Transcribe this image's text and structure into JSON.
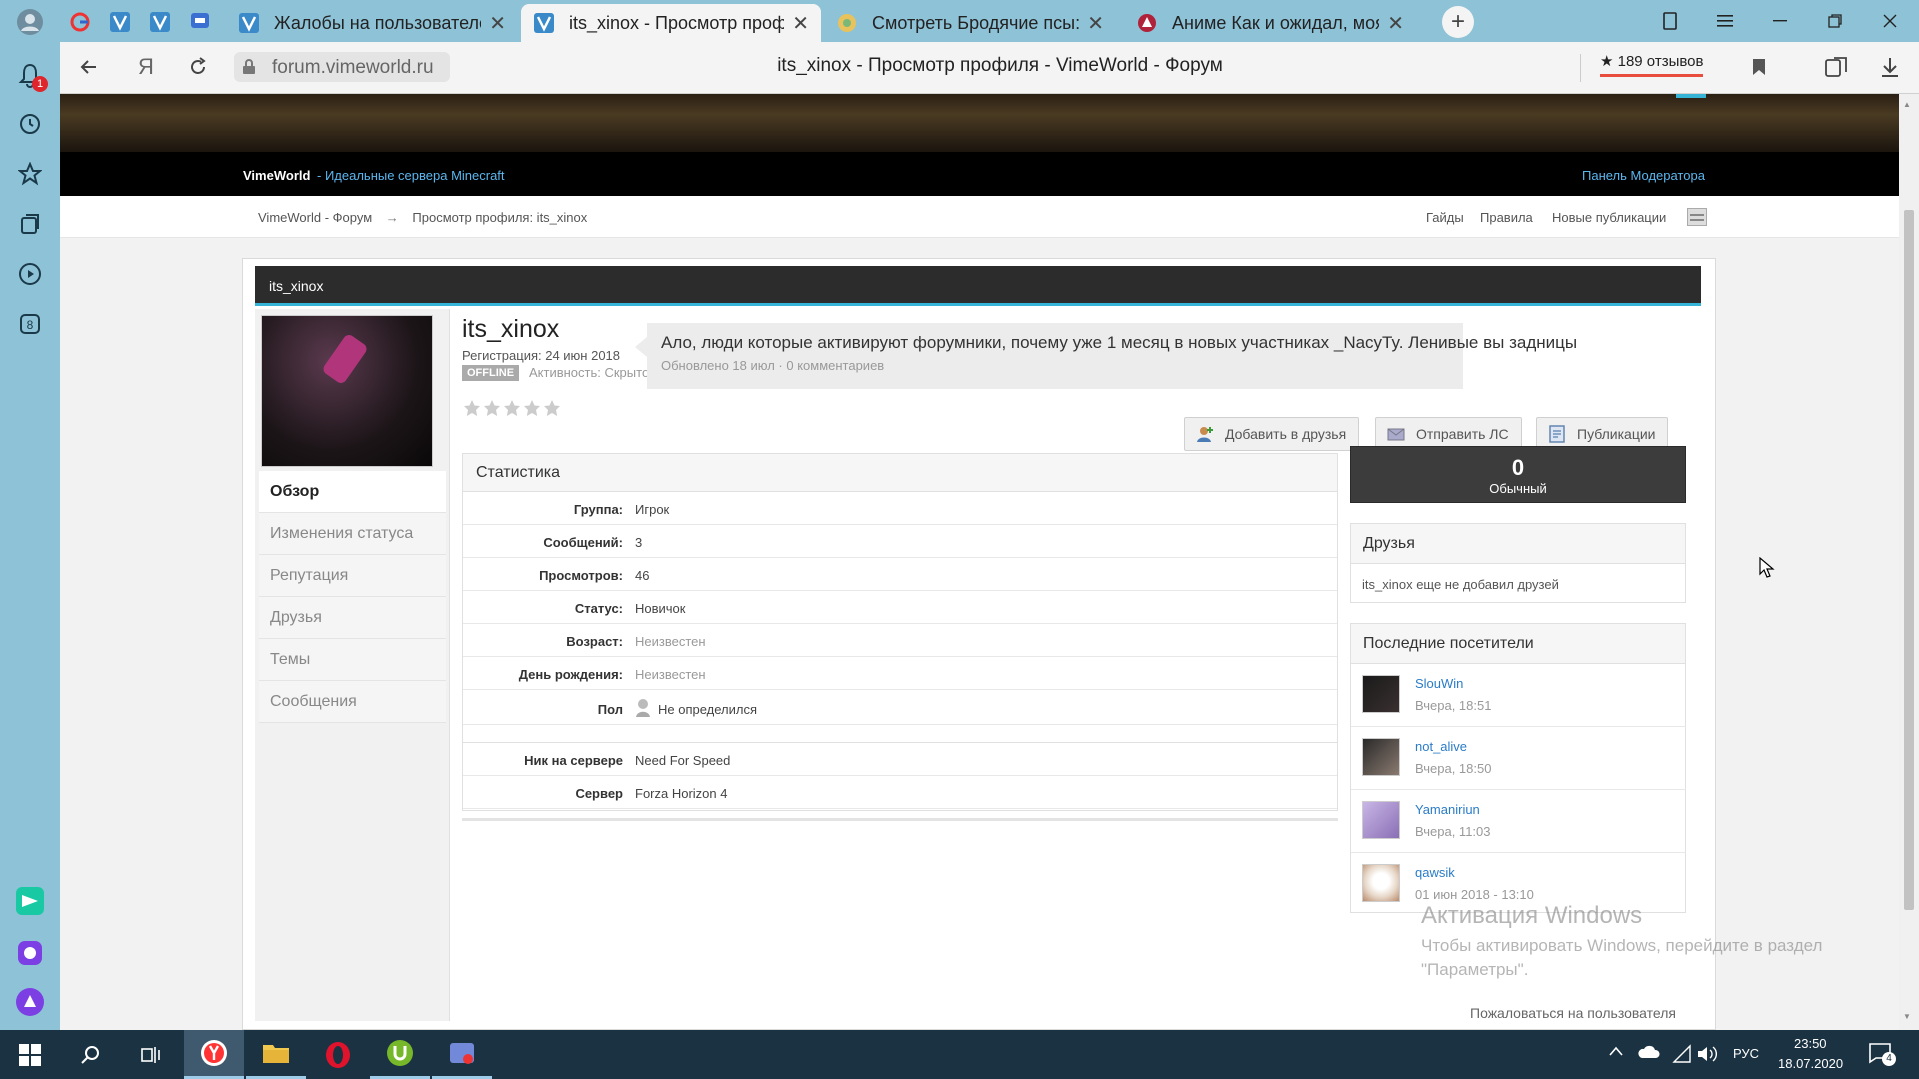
{
  "browser": {
    "tabs": [
      {
        "title": "Жалобы на пользователей"
      },
      {
        "title": "its_xinox - Просмотр профи"
      },
      {
        "title": "Смотреть Бродячие псы: Ли"
      },
      {
        "title": "Аниме Как и ожидал, моя ш"
      }
    ],
    "new_tab": "+",
    "address": "forum.vimeworld.ru",
    "page_title": "its_xinox - Просмотр профиля - VimeWorld - Форум",
    "reviews": "★ 189 отзывов",
    "notif_count": "1"
  },
  "site": {
    "brand": "VimeWorld",
    "tagline": " - Идеальные сервера Minecraft",
    "mod_panel": "Панель Модератора",
    "breadcrumb_home": "VimeWorld - Форум",
    "breadcrumb_arrow": "→",
    "breadcrumb_current": "Просмотр профиля: its_xinox",
    "nav": [
      "Гайды",
      "Правила",
      "Новые публикации"
    ]
  },
  "profile": {
    "header_title": "its_xinox",
    "username": "its_xinox",
    "registered": "Регистрация: 24 июн 2018",
    "offline_badge": "OFFLINE",
    "activity": "Активность: Скрыто",
    "status_text": "Ало, люди которые активируют форумники, почему уже 1 месяц в новых участниках _NacyTy. Ленивые вы задницы",
    "status_meta": "Обновлено 18 июл · 0 комментариев",
    "rating_stars": 0,
    "buttons": {
      "add_friend": "Добавить в друзья",
      "send_pm": "Отправить ЛС",
      "publications": "Публикации"
    },
    "menu": [
      "Обзор",
      "Изменения статуса",
      "Репутация",
      "Друзья",
      "Темы",
      "Сообщения"
    ],
    "stats_title": "Статистика",
    "stats": [
      {
        "k": "Группа:",
        "v": "Игрок"
      },
      {
        "k": "Сообщений:",
        "v": "3"
      },
      {
        "k": "Просмотров:",
        "v": "46"
      },
      {
        "k": "Статус:",
        "v": "Новичок"
      },
      {
        "k": "Возраст:",
        "v": "Неизвестен"
      },
      {
        "k": "День рождения:",
        "v": "Неизвестен"
      },
      {
        "k": "Пол",
        "v": "Не определился"
      },
      {
        "k": "Ник на сервере",
        "v": "Need For Speed"
      },
      {
        "k": "Сервер",
        "v": "Forza Horizon 4"
      }
    ],
    "rep_value": "0",
    "rep_label": "Обычный",
    "friends_title": "Друзья",
    "friends_empty": "its_xinox еще не добавил друзей",
    "visitors_title": "Последние посетители",
    "visitors": [
      {
        "name": "SlouWin",
        "time": "Вчера, 18:51"
      },
      {
        "name": "not_alive",
        "time": "Вчера, 18:50"
      },
      {
        "name": "Yamaniriun",
        "time": "Вчера, 11:03"
      },
      {
        "name": "qawsik",
        "time": "01 июн 2018 - 13:10"
      }
    ],
    "report_user": "Пожаловаться на пользователя"
  },
  "watermark": {
    "title": "Активация Windows",
    "line1": "Чтобы активировать Windows, перейдите в раздел",
    "line2": "\"Параметры\"."
  },
  "taskbar": {
    "lang": "РУС",
    "time": "23:50",
    "date": "18.07.2020",
    "notif": "4"
  }
}
